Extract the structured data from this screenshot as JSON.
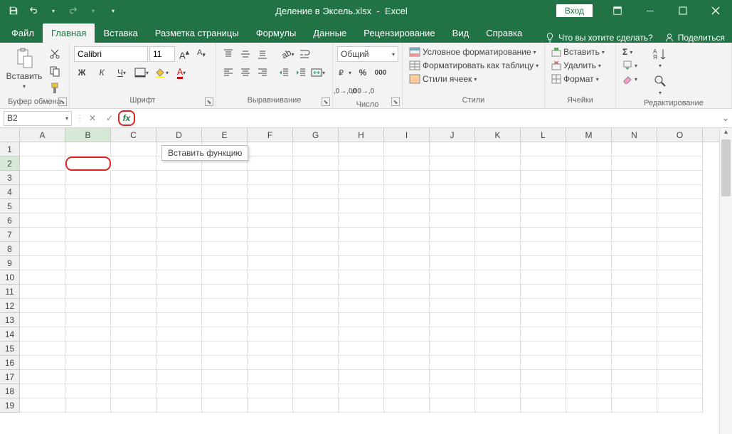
{
  "title": {
    "filename": "Деление в Эксель.xlsx",
    "app": "Excel",
    "login": "Вход"
  },
  "tabs": {
    "file": "Файл",
    "home": "Главная",
    "insert": "Вставка",
    "layout": "Разметка страницы",
    "formulas": "Формулы",
    "data": "Данные",
    "review": "Рецензирование",
    "view": "Вид",
    "help": "Справка",
    "tellme": "Что вы хотите сделать?",
    "share": "Поделиться"
  },
  "ribbon": {
    "clipboard": {
      "paste": "Вставить",
      "label": "Буфер обмена"
    },
    "font": {
      "name": "Calibri",
      "size": "11",
      "label": "Шрифт"
    },
    "alignment": {
      "label": "Выравнивание"
    },
    "number": {
      "format": "Общий",
      "label": "Число"
    },
    "styles": {
      "cond": "Условное форматирование",
      "table": "Форматировать как таблицу",
      "cell": "Стили ячеек",
      "label": "Стили"
    },
    "cells": {
      "insert": "Вставить",
      "delete": "Удалить",
      "format": "Формат",
      "label": "Ячейки"
    },
    "editing": {
      "label": "Редактирование"
    }
  },
  "formula_bar": {
    "name_box": "B2",
    "tooltip": "Вставить функцию",
    "value": ""
  },
  "grid": {
    "columns": [
      "A",
      "B",
      "C",
      "D",
      "E",
      "F",
      "G",
      "H",
      "I",
      "J",
      "K",
      "L",
      "M",
      "N",
      "O"
    ],
    "rows": [
      1,
      2,
      3,
      4,
      5,
      6,
      7,
      8,
      9,
      10,
      11,
      12,
      13,
      14,
      15,
      16,
      17,
      18,
      19
    ],
    "active_col": "B",
    "active_row": 2
  }
}
